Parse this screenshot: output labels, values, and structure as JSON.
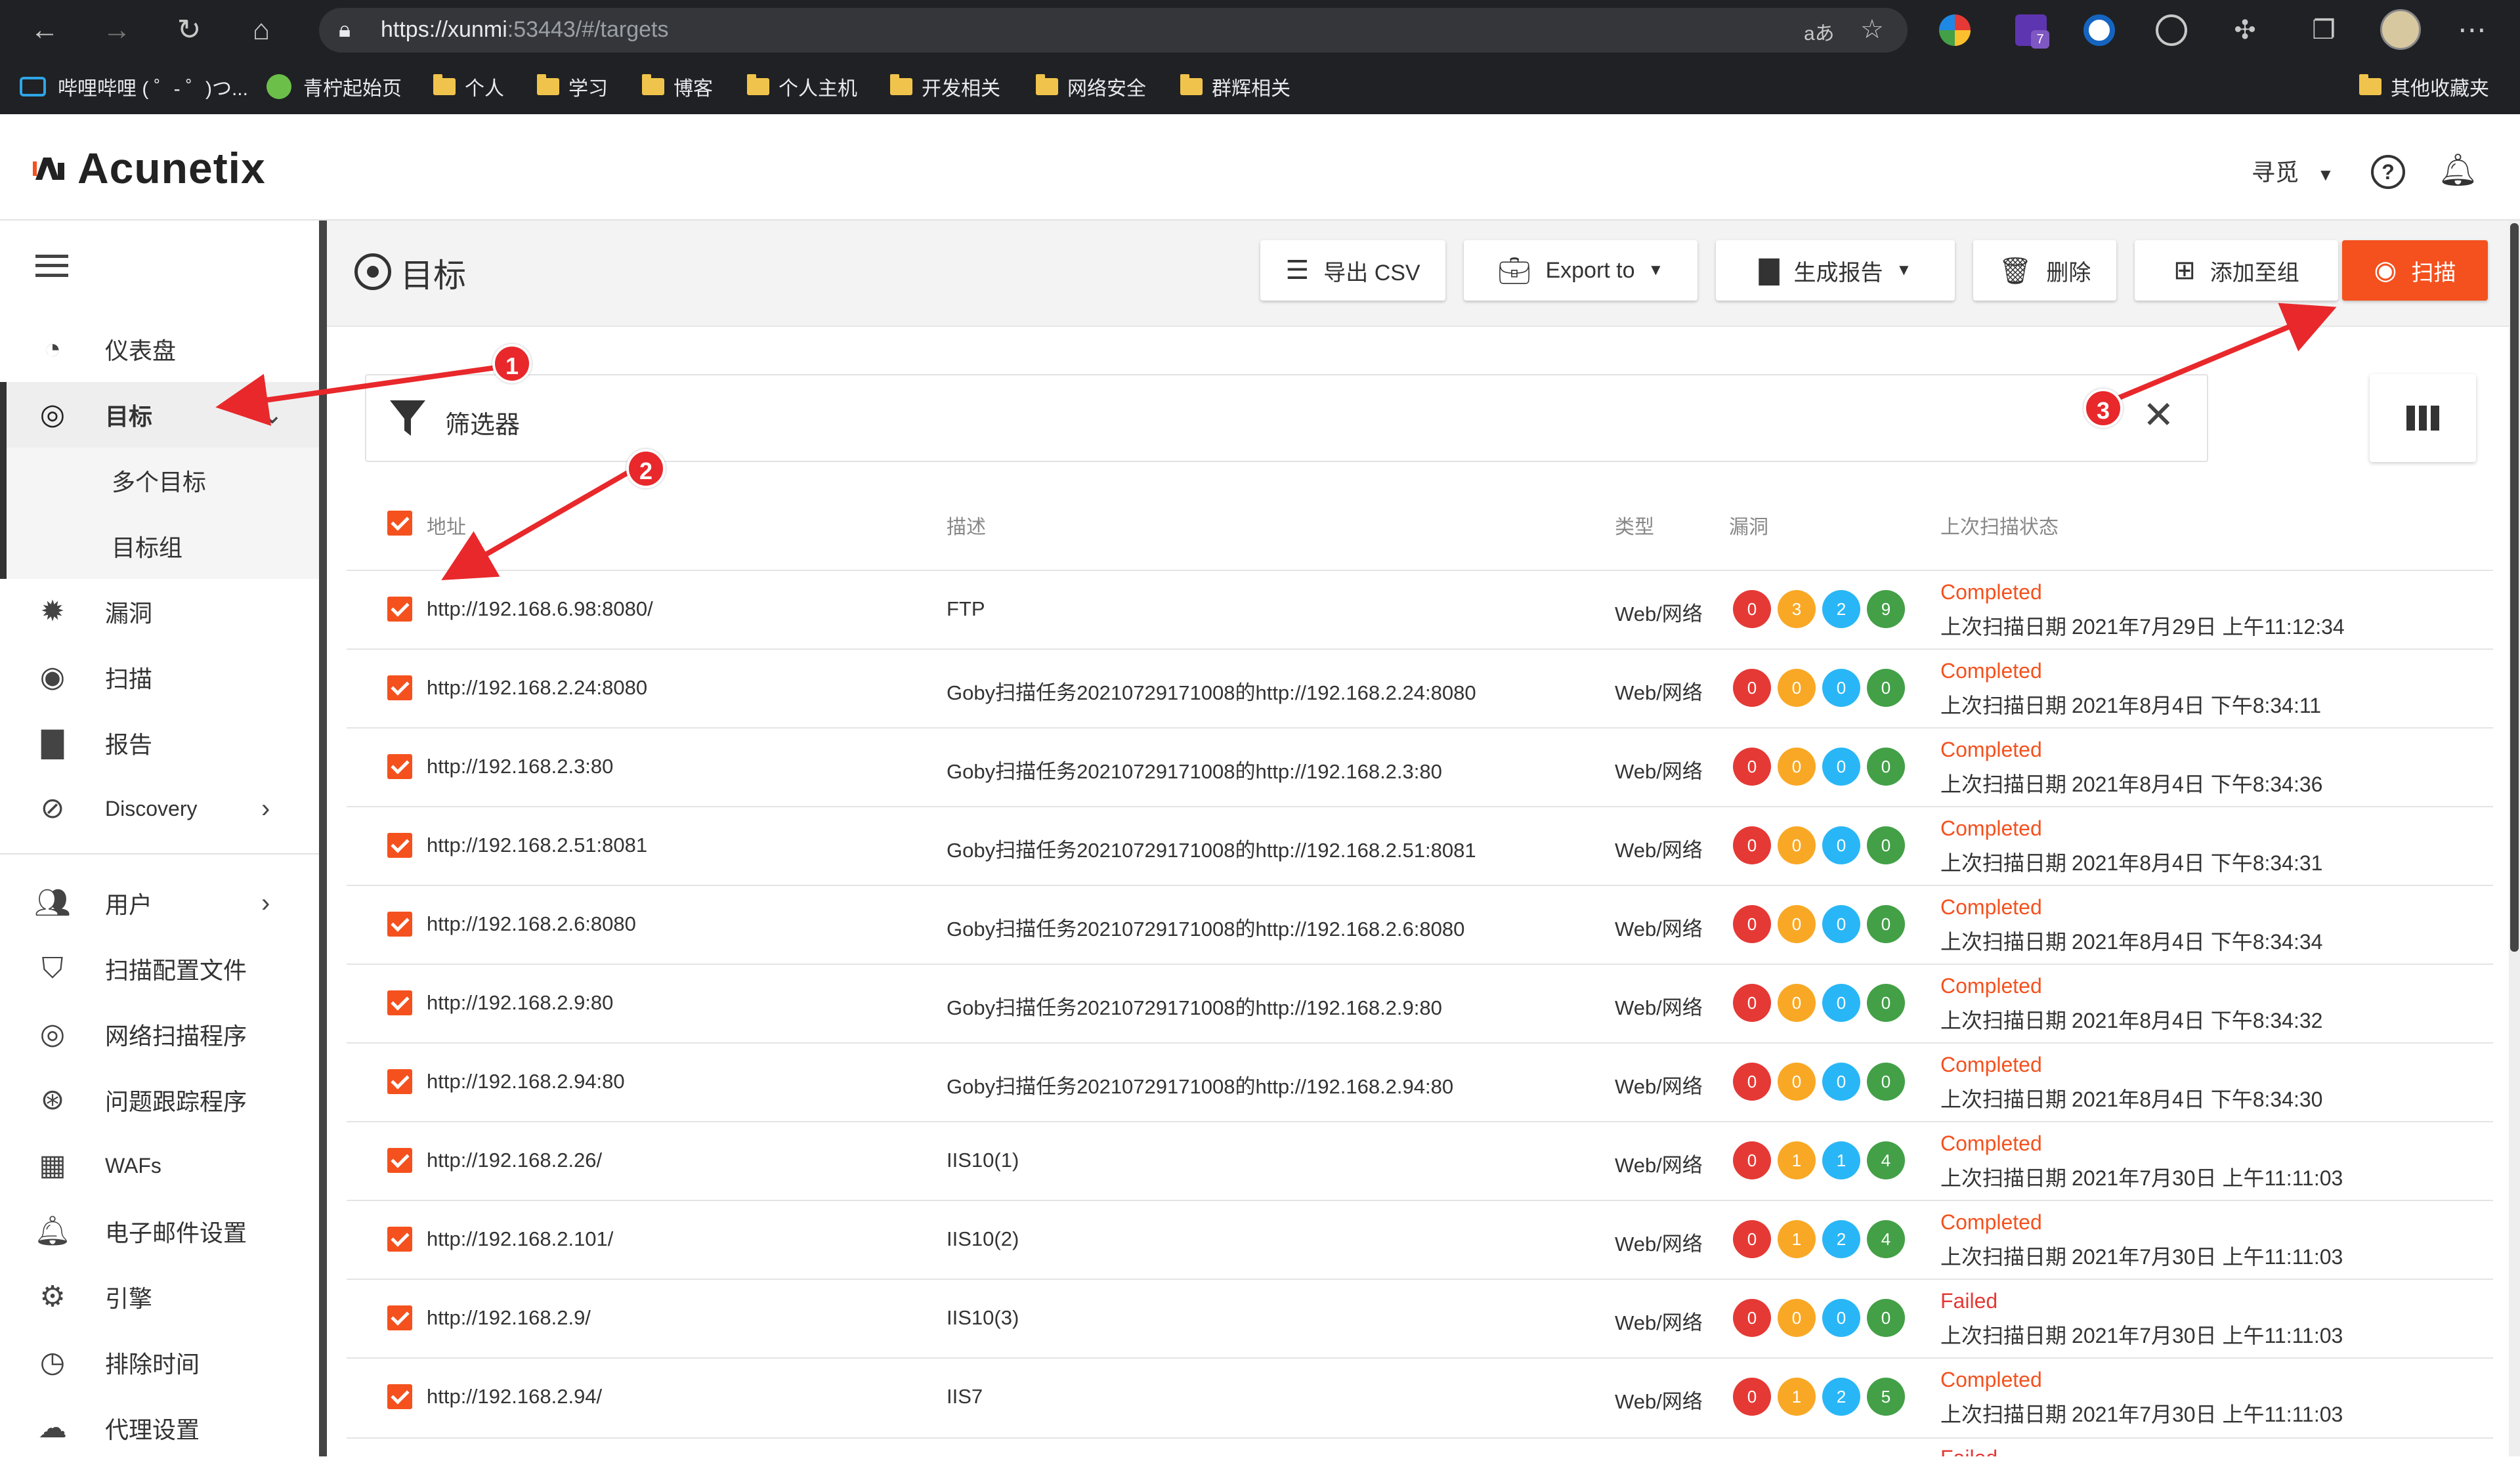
{
  "browser": {
    "url_prefix": "https://xunmi",
    "url_rest": ":53443/#/targets",
    "translate_icon": "aあ",
    "bookmarks": [
      {
        "label": "哔哩哔哩 ( ゜- ゜)つ...",
        "icon": "bilibili-icon"
      },
      {
        "label": "青柠起始页",
        "icon": "lime-icon"
      },
      {
        "label": "个人",
        "icon": "folder-icon"
      },
      {
        "label": "学习",
        "icon": "folder-icon"
      },
      {
        "label": "博客",
        "icon": "folder-icon"
      },
      {
        "label": "个人主机",
        "icon": "folder-icon"
      },
      {
        "label": "开发相关",
        "icon": "folder-icon"
      },
      {
        "label": "网络安全",
        "icon": "folder-icon"
      },
      {
        "label": "群辉相关",
        "icon": "folder-icon"
      }
    ],
    "other_bookmarks": "其他收藏夹",
    "extension_badge": "7"
  },
  "app": {
    "logo": "Acunetix",
    "user": "寻觅"
  },
  "sidebar": {
    "items": [
      {
        "label": "仪表盘",
        "icon": "dashboard-icon"
      },
      {
        "label": "目标",
        "icon": "target-icon"
      },
      {
        "label": "多个目标",
        "icon": ""
      },
      {
        "label": "目标组",
        "icon": ""
      },
      {
        "label": "漏洞",
        "icon": "bug-icon"
      },
      {
        "label": "扫描",
        "icon": "scan-icon"
      },
      {
        "label": "报告",
        "icon": "report-icon"
      },
      {
        "label": "Discovery",
        "icon": "compass-icon"
      },
      {
        "label": "用户",
        "icon": "users-icon"
      },
      {
        "label": "扫描配置文件",
        "icon": "shield-icon"
      },
      {
        "label": "网络扫描程序",
        "icon": "network-scanner-icon"
      },
      {
        "label": "问题跟踪程序",
        "icon": "issue-tracker-icon"
      },
      {
        "label": "WAFs",
        "icon": "waf-icon"
      },
      {
        "label": "电子邮件设置",
        "icon": "bell-icon"
      },
      {
        "label": "引擎",
        "icon": "chip-icon"
      },
      {
        "label": "排除时间",
        "icon": "clock-icon"
      },
      {
        "label": "代理设置",
        "icon": "cloud-icon"
      }
    ]
  },
  "page": {
    "title": "目标",
    "toolbar": {
      "export_csv": "导出 CSV",
      "export_to": "Export to",
      "generate_report": "生成报告",
      "delete": "删除",
      "add_to_group": "添加至组",
      "scan": "扫描"
    },
    "filter_label": "筛选器"
  },
  "table": {
    "headers": {
      "address": "地址",
      "description": "描述",
      "type": "类型",
      "vulns": "漏洞",
      "last_scan": "上次扫描状态"
    },
    "date_prefix": "上次扫描日期",
    "rows": [
      {
        "address": "http://192.168.6.98:8080/",
        "desc": "FTP",
        "type": "Web/网络",
        "vulns": [
          "0",
          "3",
          "2",
          "9"
        ],
        "status": "Completed",
        "date": "2021年7月29日 上午11:12:34"
      },
      {
        "address": "http://192.168.2.24:8080",
        "desc": "Goby扫描任务20210729171008的http://192.168.2.24:8080",
        "type": "Web/网络",
        "vulns": [
          "0",
          "0",
          "0",
          "0"
        ],
        "status": "Completed",
        "date": "2021年8月4日 下午8:34:11"
      },
      {
        "address": "http://192.168.2.3:80",
        "desc": "Goby扫描任务20210729171008的http://192.168.2.3:80",
        "type": "Web/网络",
        "vulns": [
          "0",
          "0",
          "0",
          "0"
        ],
        "status": "Completed",
        "date": "2021年8月4日 下午8:34:36"
      },
      {
        "address": "http://192.168.2.51:8081",
        "desc": "Goby扫描任务20210729171008的http://192.168.2.51:8081",
        "type": "Web/网络",
        "vulns": [
          "0",
          "0",
          "0",
          "0"
        ],
        "status": "Completed",
        "date": "2021年8月4日 下午8:34:31"
      },
      {
        "address": "http://192.168.2.6:8080",
        "desc": "Goby扫描任务20210729171008的http://192.168.2.6:8080",
        "type": "Web/网络",
        "vulns": [
          "0",
          "0",
          "0",
          "0"
        ],
        "status": "Completed",
        "date": "2021年8月4日 下午8:34:34"
      },
      {
        "address": "http://192.168.2.9:80",
        "desc": "Goby扫描任务20210729171008的http://192.168.2.9:80",
        "type": "Web/网络",
        "vulns": [
          "0",
          "0",
          "0",
          "0"
        ],
        "status": "Completed",
        "date": "2021年8月4日 下午8:34:32"
      },
      {
        "address": "http://192.168.2.94:80",
        "desc": "Goby扫描任务20210729171008的http://192.168.2.94:80",
        "type": "Web/网络",
        "vulns": [
          "0",
          "0",
          "0",
          "0"
        ],
        "status": "Completed",
        "date": "2021年8月4日 下午8:34:30"
      },
      {
        "address": "http://192.168.2.26/",
        "desc": "IIS10(1)",
        "type": "Web/网络",
        "vulns": [
          "0",
          "1",
          "1",
          "4"
        ],
        "status": "Completed",
        "date": "2021年7月30日 上午11:11:03"
      },
      {
        "address": "http://192.168.2.101/",
        "desc": "IIS10(2)",
        "type": "Web/网络",
        "vulns": [
          "0",
          "1",
          "2",
          "4"
        ],
        "status": "Completed",
        "date": "2021年7月30日 上午11:11:03"
      },
      {
        "address": "http://192.168.2.9/",
        "desc": "IIS10(3)",
        "type": "Web/网络",
        "vulns": [
          "0",
          "0",
          "0",
          "0"
        ],
        "status": "Failed",
        "date": "2021年7月30日 上午11:11:03"
      },
      {
        "address": "http://192.168.2.94/",
        "desc": "IIS7",
        "type": "Web/网络",
        "vulns": [
          "0",
          "1",
          "2",
          "5"
        ],
        "status": "Completed",
        "date": "2021年7月30日 上午11:11:03"
      }
    ],
    "partial_status": "Failed"
  },
  "annotations": [
    "1",
    "2",
    "3"
  ],
  "colors": {
    "accent": "#f4511e",
    "critical": "#e53935",
    "high": "#f9a825",
    "medium": "#29b6f6",
    "low": "#43a047",
    "annotation": "#e8282b"
  }
}
